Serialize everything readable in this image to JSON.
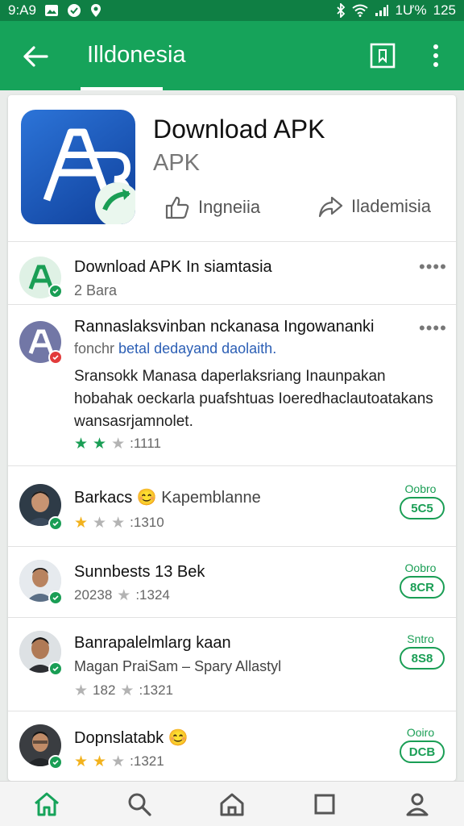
{
  "status_bar": {
    "time": "9:A9",
    "battery": "1Ư%",
    "clock_right": "125"
  },
  "app_bar": {
    "title": "Illdonesia"
  },
  "app": {
    "name": "Download APK",
    "subtitle": "APK",
    "action_left": "Ingneiia",
    "action_right": "Ilademisia"
  },
  "posts": [
    {
      "title": "Download APK In siamtasia",
      "sub": "2 Bara",
      "more": "••••"
    },
    {
      "title": "Rannaslaksvinban nckanasa Ingowananki",
      "sub_a": "fonchr ",
      "sub_b": "betal dedayand daolaith.",
      "body_lines": [
        "Sransokk Manasa daperlaksriang Inaunpakan",
        "hobahak oeckarla puafshtuas Ioeredhaclautoatakans",
        "wansasrjamnolet."
      ],
      "rating_text": ":1111",
      "more": "••••"
    }
  ],
  "reviewers": [
    {
      "name": "Barkacs",
      "extra": "Kapemblanne",
      "sub": ":1310",
      "label": "Oobro",
      "pill": "5C5",
      "star_colors": [
        "gold",
        "gray",
        "gray"
      ]
    },
    {
      "name": "Sunnbests 13 Bek",
      "extra": "",
      "sub_prefix": "20238",
      "sub": ":1324",
      "label": "Oobro",
      "pill": "8CR",
      "star_colors": [
        "gray"
      ]
    },
    {
      "name": "Banrapalelmlarg kaan",
      "extra": "",
      "sub_line": "Magan PraiSam – Spary Allastyl",
      "sub_prefix": "182",
      "sub": ":1321",
      "label": "Sntro",
      "pill": "8S8",
      "star_colors": [
        "gray",
        "gray"
      ]
    },
    {
      "name": "Dopnslatabk",
      "extra": "",
      "sub": ":1321",
      "label": "Ooiro",
      "pill": "DCB",
      "star_colors": [
        "gold",
        "gold",
        "gray"
      ]
    }
  ],
  "icons": {
    "back": "arrow-left-icon",
    "bookmark": "bookmark-icon",
    "more": "more-vert-icon",
    "thumb": "thumb-up-icon",
    "share": "share-icon",
    "nav": [
      "home-icon",
      "search-icon",
      "house-icon",
      "square-icon",
      "profile-icon"
    ]
  },
  "colors": {
    "primary": "#16a35a",
    "status_bar": "#0f7f44",
    "accent": "#1a9e55"
  }
}
